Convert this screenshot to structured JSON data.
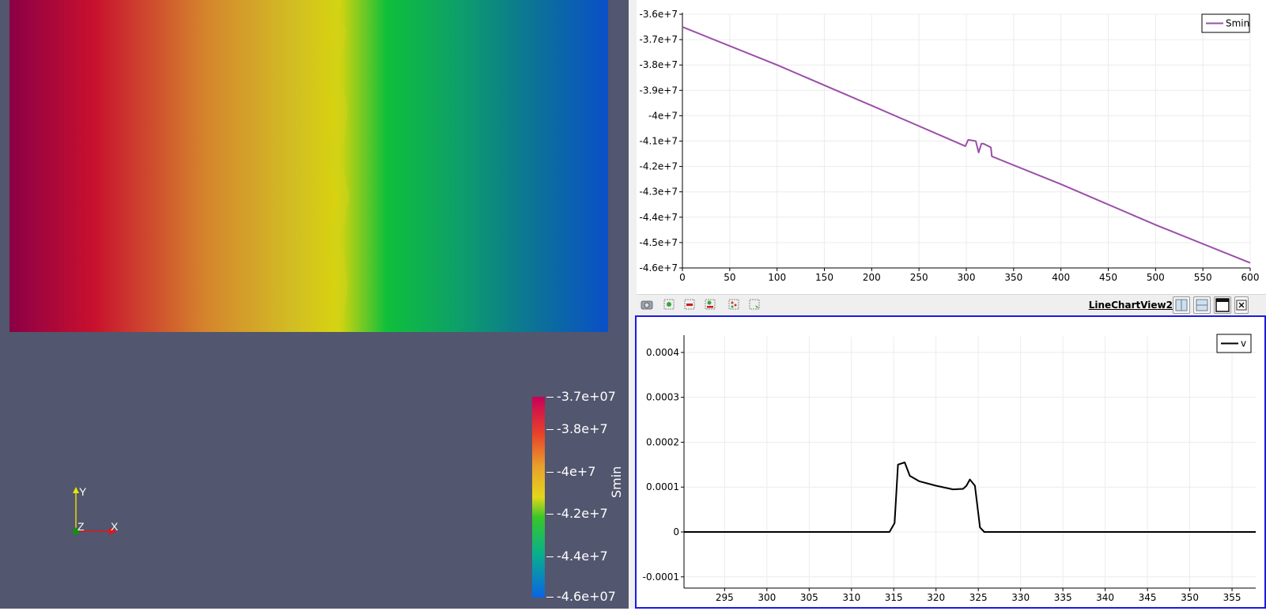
{
  "render_view": {
    "colorbar": {
      "title": "Smin",
      "labels": [
        "-3.7e+07",
        "-3.8e+7",
        "-4e+7",
        "-4.2e+7",
        "-4.4e+7",
        "-4.6e+07"
      ],
      "stops": [
        "#8b0045",
        "#c8102e",
        "#d96b28",
        "#d9c21b",
        "#c4d60c",
        "#0fbf3a",
        "#0f9a6e",
        "#0c6f9e",
        "#0a4fc8"
      ]
    },
    "axes": {
      "x": "X",
      "y": "Y",
      "z": "Z"
    }
  },
  "toolbar": {
    "view_name": "LineChartView2",
    "icons": [
      "camera-icon",
      "zoom-to-data-icon",
      "remove-selection-icon",
      "zoom-box-icon",
      "select-points-icon",
      "select-rect-icon"
    ],
    "view_controls": [
      "split-horizontal-icon",
      "split-vertical-icon",
      "maximize-icon",
      "close-icon"
    ]
  },
  "chart_data": [
    {
      "type": "line",
      "title": "",
      "xlabel": "",
      "ylabel": "",
      "xlim": [
        0,
        600
      ],
      "ylim": [
        -46000000,
        -36000000
      ],
      "x_ticks": [
        0,
        50,
        100,
        150,
        200,
        250,
        300,
        350,
        400,
        450,
        500,
        550,
        600
      ],
      "x_tick_labels": [
        "0",
        "50",
        "100",
        "150",
        "200",
        "250",
        "300",
        "350",
        "400",
        "450",
        "500",
        "550",
        "600"
      ],
      "y_ticks": [
        -36000000,
        -37000000,
        -38000000,
        -39000000,
        -40000000,
        -41000000,
        -42000000,
        -43000000,
        -44000000,
        -45000000,
        -46000000
      ],
      "y_tick_labels": [
        "-3.6e+7",
        "-3.7e+7",
        "-3.8e+7",
        "-3.9e+7",
        "-4e+7",
        "-4.1e+7",
        "-4.2e+7",
        "-4.3e+7",
        "-4.4e+7",
        "-4.5e+7",
        "-4.6e+7"
      ],
      "grid": true,
      "legend": "top-right",
      "series": [
        {
          "name": "Smin",
          "color": "#9b4fa8",
          "x": [
            0,
            100,
            200,
            299,
            302,
            310,
            313,
            316,
            318,
            326,
            327,
            400,
            500,
            600
          ],
          "y": [
            -36500000,
            -38000000,
            -39600000,
            -41200000,
            -40950000,
            -41000000,
            -41450000,
            -41100000,
            -41100000,
            -41250000,
            -41600000,
            -42700000,
            -44300000,
            -45800000
          ]
        }
      ]
    },
    {
      "type": "line",
      "title": "",
      "xlabel": "",
      "ylabel": "",
      "xlim": [
        290.2,
        357.8
      ],
      "ylim": [
        -0.000125,
        0.000435
      ],
      "x_ticks": [
        295,
        300,
        305,
        310,
        315,
        320,
        325,
        330,
        335,
        340,
        345,
        350,
        355
      ],
      "x_tick_labels": [
        "295",
        "300",
        "305",
        "310",
        "315",
        "320",
        "325",
        "330",
        "335",
        "340",
        "345",
        "350",
        "355"
      ],
      "y_ticks": [
        0.0004,
        0.0003,
        0.0002,
        0.0001,
        0,
        -0.0001
      ],
      "y_tick_labels": [
        "0.0004",
        "0.0003",
        "0.0002",
        "0.0001",
        "0",
        "-0.0001"
      ],
      "grid": true,
      "legend": "top-right",
      "series": [
        {
          "name": "v",
          "color": "#000000",
          "x": [
            290.2,
            314.5,
            315.1,
            315.5,
            316.3,
            316.9,
            318,
            320,
            322,
            323.2,
            323.6,
            324,
            324.6,
            325.2,
            325.7,
            357.8
          ],
          "y": [
            0,
            0,
            2e-05,
            0.00015,
            0.000155,
            0.000125,
            0.000113,
            0.000103,
            9.5e-05,
            9.6e-05,
            0.000103,
            0.000117,
            0.000103,
            1e-05,
            0,
            0
          ]
        }
      ]
    }
  ]
}
